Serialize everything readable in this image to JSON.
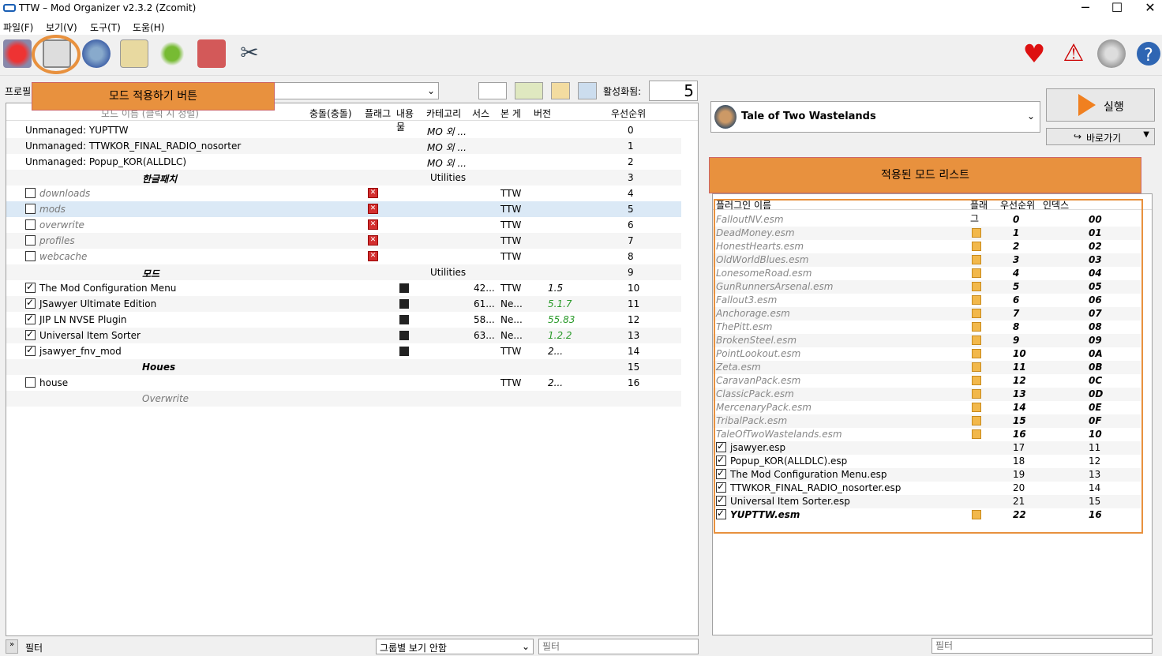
{
  "window": {
    "title": "TTW – Mod Organizer v2.3.2 (Zcomit)",
    "min": "─",
    "max": "☐",
    "close": "✕"
  },
  "menu": [
    "파일(F)",
    "보기(V)",
    "도구(T)",
    "도움(H)"
  ],
  "left": {
    "profile_label": "프로필",
    "active_label": "활성화됨:",
    "active_count": "5",
    "headers": [
      "모드 이름 (클릭 시 정렬)",
      "충돌(충돌)",
      "플래그",
      "내용물",
      "카테고리",
      "서스",
      "본 게",
      "버전",
      "우선순위"
    ],
    "rows": [
      {
        "name": "Unmanaged: YUPTTW",
        "cat": "MO 외 ...",
        "pri": "0"
      },
      {
        "name": "Unmanaged: TTWKOR_FINAL_RADIO_nosorter",
        "cat": "MO 외 ...",
        "pri": "1"
      },
      {
        "name": "Unmanaged: Popup_KOR(ALLDLC)",
        "cat": "MO 외 ...",
        "pri": "2"
      },
      {
        "sep": "한글패치",
        "cat": "Utilities",
        "pri": "3"
      },
      {
        "name": "downloads",
        "it": true,
        "x": true,
        "game": "TTW",
        "pri": "4"
      },
      {
        "name": "mods",
        "it": true,
        "x": true,
        "game": "TTW",
        "pri": "5"
      },
      {
        "name": "overwrite",
        "it": true,
        "x": true,
        "game": "TTW",
        "pri": "6"
      },
      {
        "name": "profiles",
        "it": true,
        "x": true,
        "game": "TTW",
        "pri": "7"
      },
      {
        "name": "webcache",
        "it": true,
        "x": true,
        "game": "TTW",
        "pri": "8"
      },
      {
        "sep": "모드",
        "cat": "Utilities",
        "pri": "9"
      },
      {
        "name": "The Mod Configuration Menu",
        "on": true,
        "src": "42...",
        "game": "TTW",
        "ver": "1.5",
        "pri": "10"
      },
      {
        "name": "JSawyer Ultimate Edition",
        "on": true,
        "src": "61...",
        "game": "Ne...",
        "ver": "5.1.7",
        "green": true,
        "pri": "11"
      },
      {
        "name": "JIP LN NVSE Plugin",
        "on": true,
        "src": "58...",
        "game": "Ne...",
        "ver": "55.83",
        "green": true,
        "pri": "12"
      },
      {
        "name": "Universal Item Sorter",
        "on": true,
        "src": "63...",
        "game": "Ne...",
        "ver": "1.2.2",
        "green": true,
        "pri": "13"
      },
      {
        "name": "jsawyer_fnv_mod",
        "on": true,
        "game": "TTW",
        "ver": "2...",
        "pri": "14"
      },
      {
        "sep": "Houes",
        "pri": "15"
      },
      {
        "name": "house",
        "on": false,
        "game": "TTW",
        "ver": "2...",
        "pri": "16"
      },
      {
        "overwrite": "Overwrite"
      }
    ],
    "filter_label": "필터",
    "group_label": "그룹별 보기 안함",
    "filter_placeholder": "필터"
  },
  "right": {
    "game": "Tale of Two Wastelands",
    "run": "실행",
    "shortcut": "바로가기",
    "headers": [
      "플러그인 이름",
      "플래그",
      "우선순위",
      "인덱스"
    ],
    "plugins": [
      [
        "FalloutNV.esm",
        "0",
        "00",
        false,
        false
      ],
      [
        "DeadMoney.esm",
        "1",
        "01",
        true,
        false
      ],
      [
        "HonestHearts.esm",
        "2",
        "02",
        true,
        false
      ],
      [
        "OldWorldBlues.esm",
        "3",
        "03",
        true,
        false
      ],
      [
        "LonesomeRoad.esm",
        "4",
        "04",
        true,
        false
      ],
      [
        "GunRunnersArsenal.esm",
        "5",
        "05",
        true,
        false
      ],
      [
        "Fallout3.esm",
        "6",
        "06",
        true,
        false
      ],
      [
        "Anchorage.esm",
        "7",
        "07",
        true,
        false
      ],
      [
        "ThePitt.esm",
        "8",
        "08",
        true,
        false
      ],
      [
        "BrokenSteel.esm",
        "9",
        "09",
        true,
        false
      ],
      [
        "PointLookout.esm",
        "10",
        "0A",
        true,
        false
      ],
      [
        "Zeta.esm",
        "11",
        "0B",
        true,
        false
      ],
      [
        "CaravanPack.esm",
        "12",
        "0C",
        true,
        false
      ],
      [
        "ClassicPack.esm",
        "13",
        "0D",
        true,
        false
      ],
      [
        "MercenaryPack.esm",
        "14",
        "0E",
        true,
        false
      ],
      [
        "TribalPack.esm",
        "15",
        "0F",
        true,
        false
      ],
      [
        "TaleOfTwoWastelands.esm",
        "16",
        "10",
        true,
        false
      ],
      [
        "jsawyer.esp",
        "17",
        "11",
        false,
        true
      ],
      [
        "Popup_KOR(ALLDLC).esp",
        "18",
        "12",
        false,
        true
      ],
      [
        "The Mod Configuration Menu.esp",
        "19",
        "13",
        false,
        true
      ],
      [
        "TTWKOR_FINAL_RADIO_nosorter.esp",
        "20",
        "14",
        false,
        true
      ],
      [
        "Universal Item Sorter.esp",
        "21",
        "15",
        false,
        true
      ],
      [
        "YUPTTW.esm",
        "22",
        "16",
        true,
        true
      ]
    ],
    "filter_placeholder": "필터"
  },
  "annotations": {
    "apply_button": "모드 적용하기 버튼",
    "applied_list": "적용된 모드 리스트"
  }
}
